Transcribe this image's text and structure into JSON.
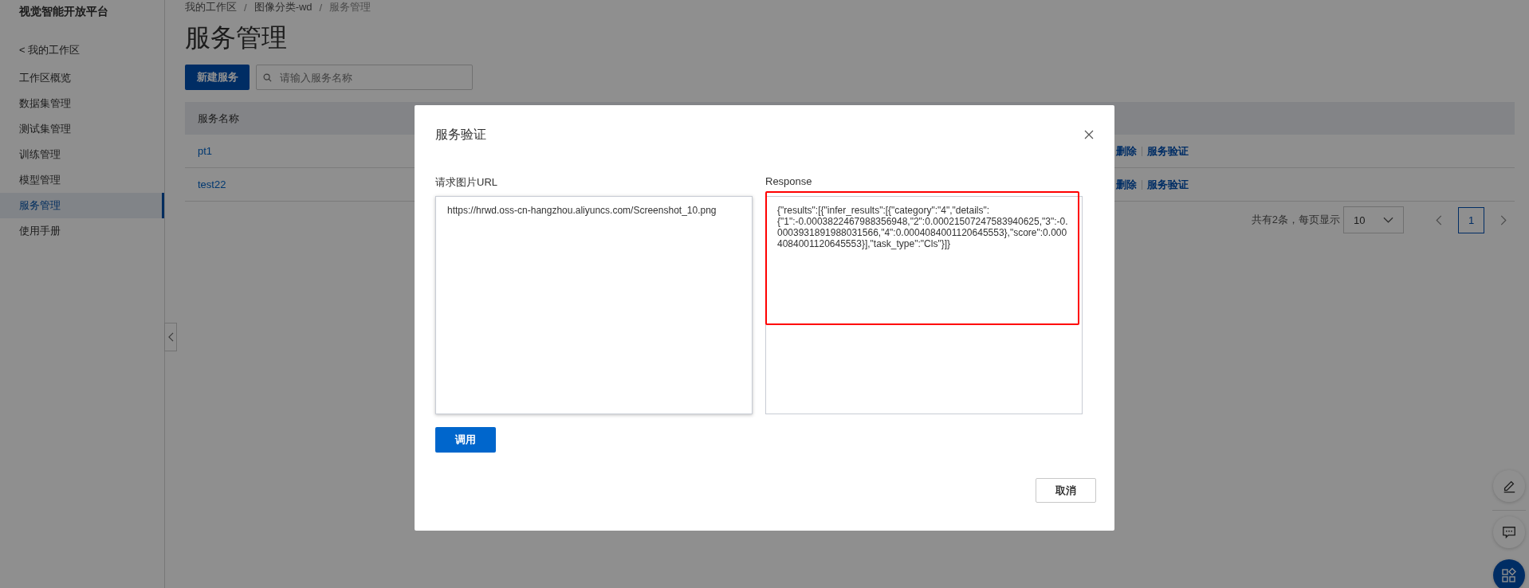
{
  "sidebar": {
    "title": "视觉智能开放平台",
    "back_link": "< 我的工作区",
    "items": [
      {
        "label": "工作区概览",
        "selected": false
      },
      {
        "label": "数据集管理",
        "selected": false
      },
      {
        "label": "测试集管理",
        "selected": false
      },
      {
        "label": "训练管理",
        "selected": false
      },
      {
        "label": "模型管理",
        "selected": false
      },
      {
        "label": "服务管理",
        "selected": true
      },
      {
        "label": "使用手册",
        "selected": false
      }
    ]
  },
  "breadcrumb": {
    "separator": "/",
    "items": [
      "我的工作区",
      "图像分类-wd",
      "服务管理"
    ]
  },
  "page_title": "服务管理",
  "toolbar": {
    "new_button": "新建服务",
    "search": {
      "placeholder": "请输入服务名称"
    }
  },
  "table": {
    "columns": [
      "服务名称"
    ],
    "rows": [
      {
        "name": "pt1",
        "actions": [
          "删除",
          "服务验证"
        ]
      },
      {
        "name": "test22",
        "actions": [
          "删除",
          "服务验证"
        ]
      }
    ]
  },
  "pagination": {
    "summary": "共有2条，每页显示",
    "page_size": "10",
    "pages": [
      {
        "label": "1",
        "selected": true
      }
    ]
  },
  "dialog": {
    "title": "服务验证",
    "url_label": "请求图片URL",
    "url_value": "https://hrwd.oss-cn-hangzhou.aliyuncs.com/Screenshot_10.png",
    "response_label": "Response",
    "response_value": "{\"results\":[{\"infer_results\":[{\"category\":\"4\",\"details\":{\"1\":-0.0003822467988356948,\"2\":0.00021507247583940625,\"3\":-0.0003931891988031566,\"4\":0.0004084001120645553},\"score\":0.0004084001120645553}],\"task_type\":\"Cls\"}]}",
    "response_highlighted": true,
    "invoke_button": "调用",
    "cancel_button": "取消"
  }
}
